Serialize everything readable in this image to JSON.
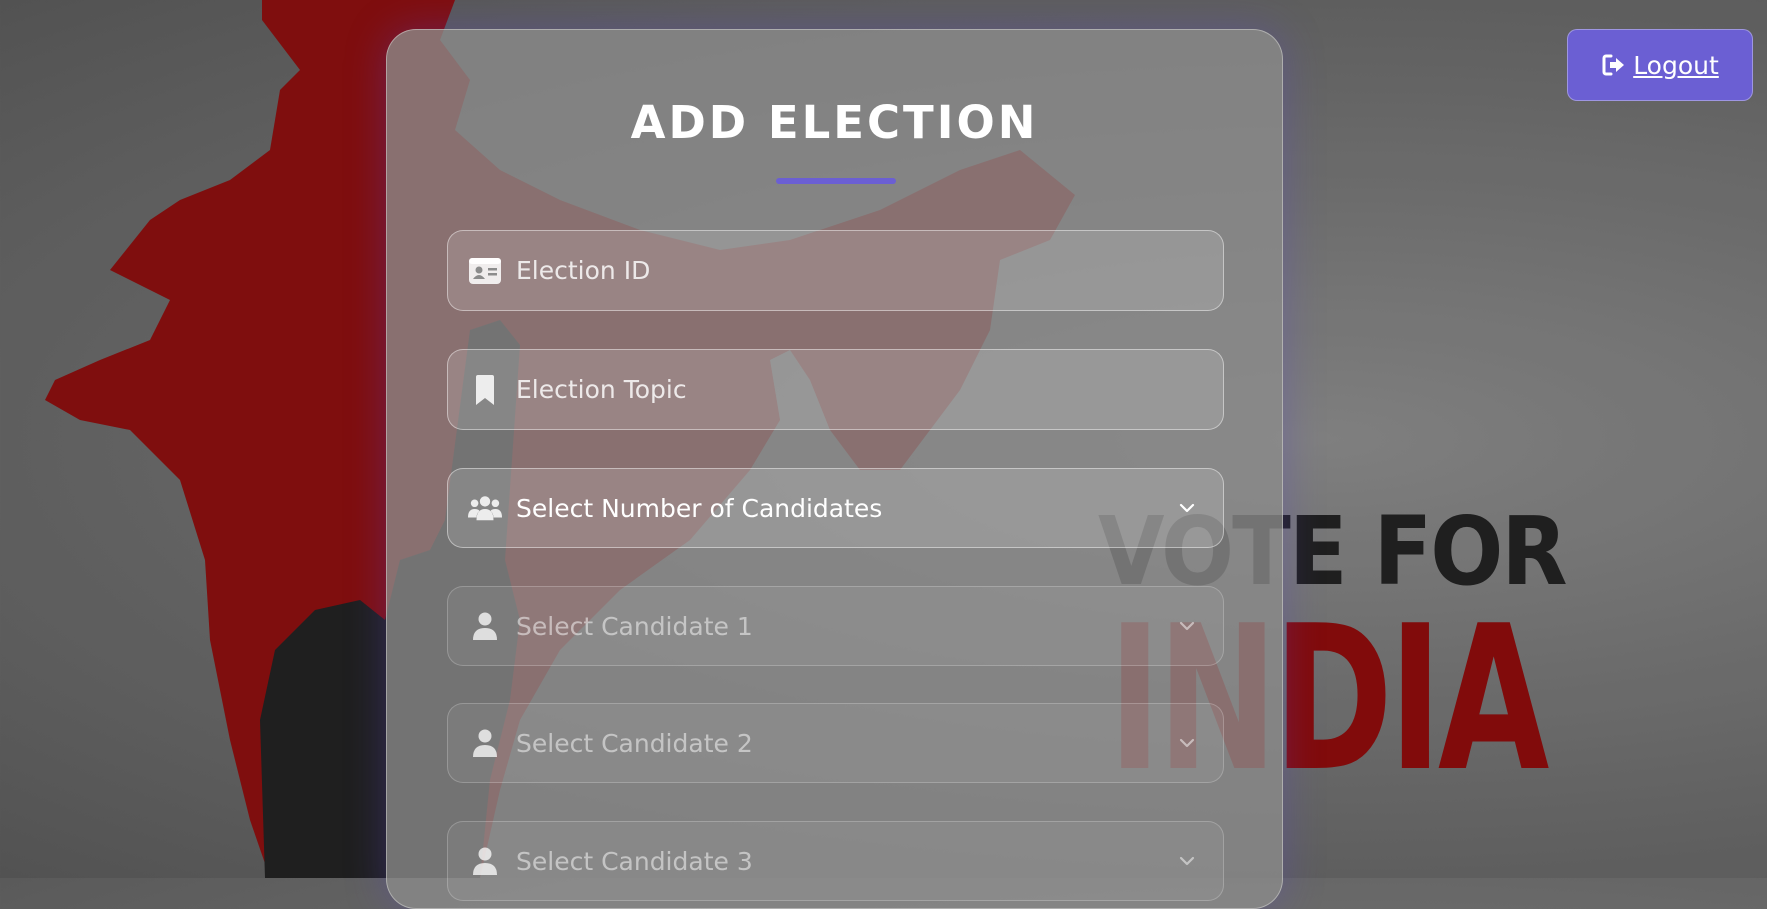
{
  "background": {
    "vote_text": "VOTE FOR",
    "india_text": "INDIA"
  },
  "header": {
    "logout_label": "Logout",
    "logout_icon": "sign-out-icon"
  },
  "form": {
    "title": "ADD ELECTION",
    "accent_color": "#6b5fd3",
    "fields": [
      {
        "icon": "id-card-icon",
        "placeholder": "Election ID"
      },
      {
        "icon": "bookmark-icon",
        "placeholder": "Election Topic"
      },
      {
        "icon": "users-icon",
        "value": "Select Number of Candidates"
      },
      {
        "icon": "user-icon",
        "value": "Select Candidate 1",
        "disabled": true
      },
      {
        "icon": "user-icon",
        "value": "Select Candidate 2",
        "disabled": true
      },
      {
        "icon": "user-icon",
        "value": "Select Candidate 3",
        "disabled": true
      }
    ]
  }
}
